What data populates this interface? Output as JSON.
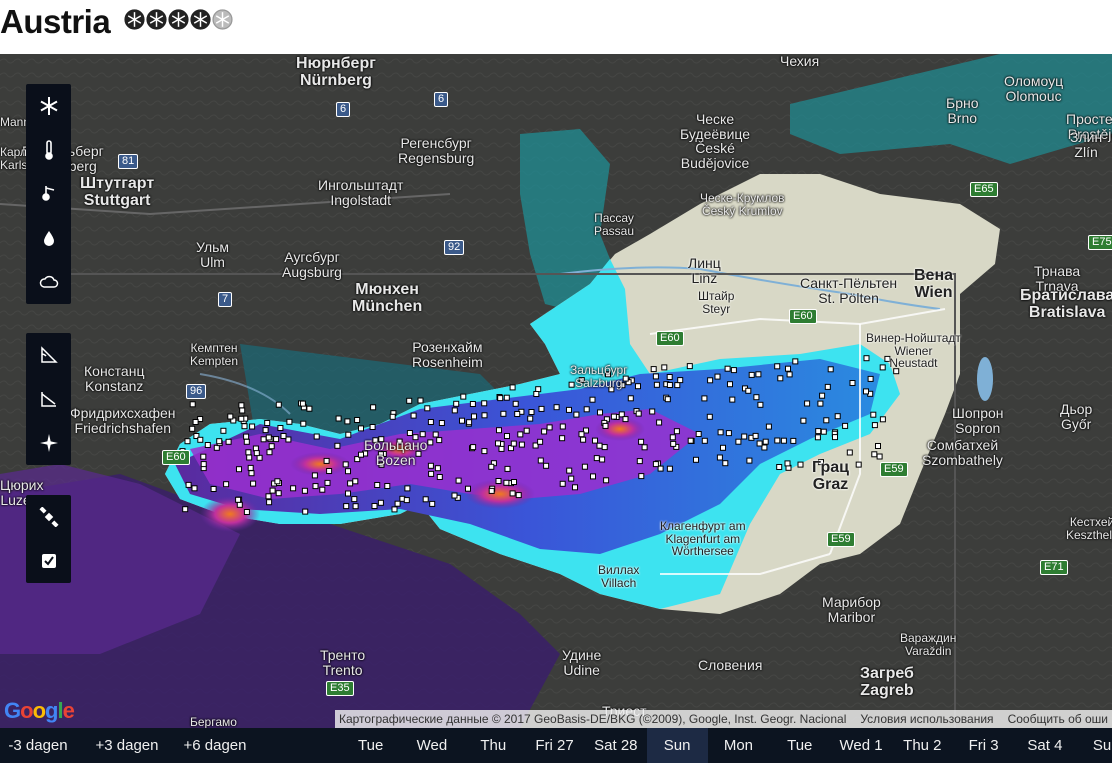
{
  "title": "Austria",
  "rating": {
    "filled": 4,
    "total": 5,
    "icon": "snowflake-rating-icon"
  },
  "map": {
    "labels": [
      {
        "text": "Mannheim",
        "cls": "small"
      },
      {
        "text": "Гейдельберг\nHeidelberg",
        "cls": "mid"
      },
      {
        "text": "Нюрнберг\nNürnberg",
        "cls": "big"
      },
      {
        "text": "Регенсбург\nRegensburg",
        "cls": "mid"
      },
      {
        "text": "Штутгарт\nStuttgart",
        "cls": "big"
      },
      {
        "text": "Ингольштадт\nIngolstadt",
        "cls": "mid"
      },
      {
        "text": "Ульм\nUlm",
        "cls": "mid"
      },
      {
        "text": "Аугсбург\nAugsburg",
        "cls": "mid"
      },
      {
        "text": "Мюнхен\nMünchen",
        "cls": "big"
      },
      {
        "text": "Кемптен\nKempten",
        "cls": "small"
      },
      {
        "text": "Розенхайм\nRosenheim",
        "cls": "mid"
      },
      {
        "text": "Констанц\nKonstanz",
        "cls": "mid"
      },
      {
        "text": "Фридрихсхафен\nFriedrichshafen",
        "cls": "mid"
      },
      {
        "text": "Пассау\nPassau",
        "cls": "small"
      },
      {
        "text": "Ческе\nБудеёвице\nČeské\nBudějovice",
        "cls": "mid"
      },
      {
        "text": "Ческе-Крумлов\nČeský Krumlov",
        "cls": "small"
      },
      {
        "text": "Линц\nLinz",
        "cls": "mid dark"
      },
      {
        "text": "Штайр\nSteyr",
        "cls": "small dark"
      },
      {
        "text": "Санкт-Пёльтен\nSt. Pölten",
        "cls": "mid dark"
      },
      {
        "text": "Вена\nWien",
        "cls": "big dark"
      },
      {
        "text": "Винер-Нойштадт\nWiener\nNeustadt",
        "cls": "small dark"
      },
      {
        "text": "Шопрон\nSopron",
        "cls": "mid"
      },
      {
        "text": "Сомбатхей\nSzombathely",
        "cls": "mid"
      },
      {
        "text": "Грац\nGraz",
        "cls": "big dark"
      },
      {
        "text": "Зальцбург\nSalzburg",
        "cls": "small"
      },
      {
        "text": "Клагенфурт am\nKlagenfurt am\nWörthersee",
        "cls": "small dark"
      },
      {
        "text": "Виллах\nVillach",
        "cls": "small dark"
      },
      {
        "text": "Марибор\nMaribor",
        "cls": "mid"
      },
      {
        "text": "Вараждин\nVaraždin",
        "cls": "small"
      },
      {
        "text": "Загреб\nZagreb",
        "cls": "big"
      },
      {
        "text": "Словения",
        "cls": "mid"
      },
      {
        "text": "Удине\nUdine",
        "cls": "mid"
      },
      {
        "text": "Тренто\nTrento",
        "cls": "mid"
      },
      {
        "text": "Больцано\nBozen",
        "cls": "mid"
      },
      {
        "text": "Триест",
        "cls": "mid"
      },
      {
        "text": "Бергамо",
        "cls": "small"
      },
      {
        "text": "Цюрих\nLuzern",
        "cls": "mid"
      },
      {
        "text": "Брно\nBrno",
        "cls": "mid"
      },
      {
        "text": "Оломоуц\nOlomouc",
        "cls": "mid"
      },
      {
        "text": "Простеёв\nProstějov",
        "cls": "mid"
      },
      {
        "text": "Злин\nZlín",
        "cls": "mid"
      },
      {
        "text": "Трнава\nTrnava",
        "cls": "mid"
      },
      {
        "text": "Братислава\nBratislava",
        "cls": "big"
      },
      {
        "text": "Дьор\nGyőr",
        "cls": "mid"
      },
      {
        "text": "Кестхей\nKeszthely",
        "cls": "small"
      },
      {
        "text": "Чехия",
        "cls": "mid"
      },
      {
        "text": "Карлсруэ\nKarlsruhe",
        "cls": "small"
      }
    ],
    "roads": [
      "E60",
      "E60",
      "E60",
      "E59",
      "E59",
      "E65",
      "E75",
      "E71",
      "E35",
      "6",
      "6",
      "81",
      "92",
      "7",
      "96"
    ],
    "attribution": {
      "data": "Картографические данные © 2017 GeoBasis-DE/BKG (©2009), Google, Inst. Geogr. Nacional",
      "terms": "Условия использования",
      "report": "Сообщить об оши"
    },
    "google_logo": "Google"
  },
  "toolbar_1": [
    {
      "icon": "snowflake-icon",
      "label": "snow"
    },
    {
      "icon": "thermometer-icon",
      "label": "temperature"
    },
    {
      "icon": "wind-icon",
      "label": "wind"
    },
    {
      "icon": "droplet-icon",
      "label": "precipitation"
    },
    {
      "icon": "cloud-icon",
      "label": "clouds"
    }
  ],
  "toolbar_2": [
    {
      "icon": "slope-icon",
      "label": "slope"
    },
    {
      "icon": "slope-aspect-icon",
      "label": "aspect"
    },
    {
      "icon": "compass-icon",
      "label": "orientation"
    }
  ],
  "toolbar_3": [
    {
      "icon": "satellite-icon",
      "label": "satellite"
    },
    {
      "icon": "checkbox-icon",
      "label": "stations"
    }
  ],
  "timebar": {
    "jumps": [
      "-3 dagen",
      "+3 dagen",
      "+6 dagen"
    ],
    "days": [
      "Tue",
      "Wed",
      "Thu",
      "Fri 27",
      "Sat 28",
      "Sun",
      "Mon",
      "Tue",
      "Wed 1",
      "Thu 2",
      "Fri 3",
      "Sat 4",
      "Sun"
    ],
    "active_index": 5
  },
  "colors": {
    "accent_active": "#1d2a44",
    "toolbar_bg": "#0a0f1a",
    "snow_light": "#39e4f2",
    "snow_mid": "#2f62e0",
    "snow_heavy": "#b135c9",
    "snow_extreme": "#f07a1f"
  }
}
